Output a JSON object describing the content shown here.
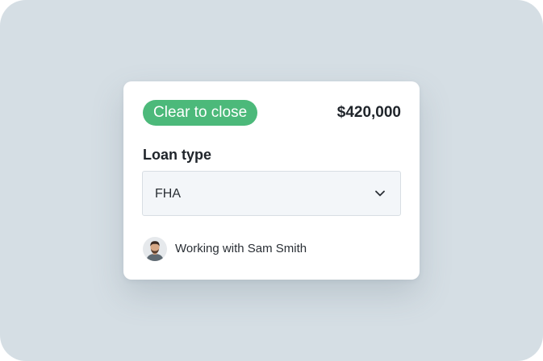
{
  "card": {
    "status_badge": "Clear to close",
    "amount": "$420,000",
    "loan_type": {
      "label": "Loan type",
      "selected_value": "FHA"
    },
    "agent_text": "Working with Sam Smith"
  },
  "colors": {
    "backdrop": "#d5dee4",
    "badge": "#4cb97a",
    "card": "#ffffff",
    "select_bg": "#f3f6f9"
  },
  "icons": {
    "select": "chevron-down-icon",
    "agent": "avatar-photo"
  }
}
